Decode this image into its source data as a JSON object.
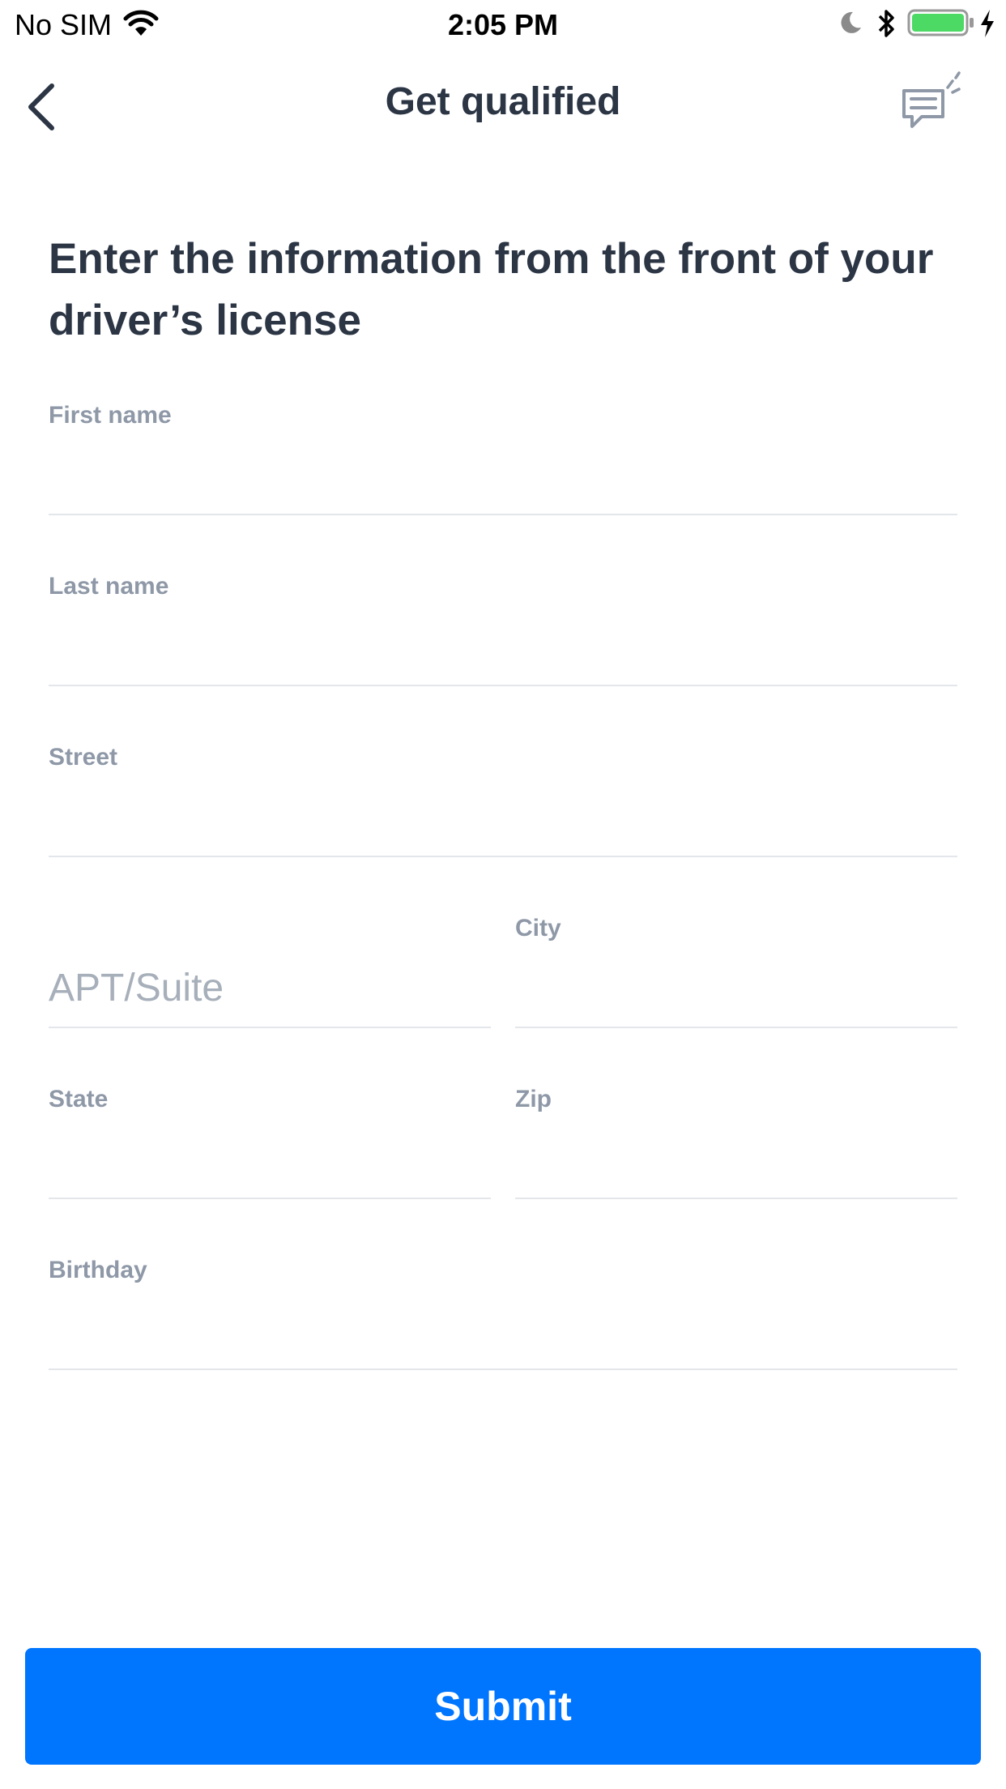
{
  "status_bar": {
    "carrier": "No SIM",
    "time": "2:05 PM",
    "icons": [
      "wifi-icon",
      "moon-icon",
      "bluetooth-icon",
      "battery-icon",
      "charging-bolt-icon"
    ],
    "battery_color": "#4cd964"
  },
  "nav": {
    "title": "Get qualified",
    "back_icon": "chevron-left-icon",
    "chat_icon": "chat-bubble-icon"
  },
  "heading": "Enter the information from the front of your driver’s license",
  "form": {
    "first_name_label": "First name",
    "last_name_label": "Last name",
    "street_label": "Street",
    "apt_placeholder": "APT/Suite",
    "city_label": "City",
    "state_label": "State",
    "zip_label": "Zip",
    "birthday_label": "Birthday"
  },
  "submit_label": "Submit",
  "colors": {
    "primary": "#0076ff",
    "text": "#2b3544",
    "label": "#8e98a7",
    "divider": "#e3e6ea"
  }
}
